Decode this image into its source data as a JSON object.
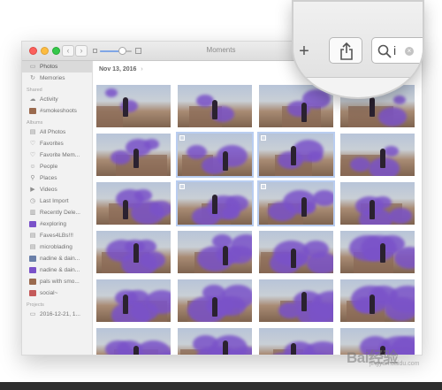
{
  "window": {
    "title": "Moments"
  },
  "toolbar": {
    "back_glyph": "‹",
    "forward_glyph": "›",
    "zoom_level": 0.7,
    "add_glyph": "+",
    "search_placeholder": ""
  },
  "sidebar": {
    "items_top": [
      {
        "label": "Photos",
        "icon": "photos-icon",
        "selected": true
      },
      {
        "label": "Memories",
        "icon": "memories-icon",
        "selected": false
      }
    ],
    "shared_heading": "Shared",
    "shared_items": [
      {
        "label": "Activity",
        "icon": "cloud-icon"
      },
      {
        "label": "#smokeshoots",
        "icon": "album-thumb-icon"
      }
    ],
    "albums_heading": "Albums",
    "album_items": [
      {
        "label": "All Photos",
        "icon": "album-stack-icon"
      },
      {
        "label": "Favorites",
        "icon": "heart-icon"
      },
      {
        "label": "Favorite Mem...",
        "icon": "heart-icon"
      },
      {
        "label": "People",
        "icon": "person-icon"
      },
      {
        "label": "Places",
        "icon": "pin-icon"
      },
      {
        "label": "Videos",
        "icon": "video-icon"
      },
      {
        "label": "Last Import",
        "icon": "clock-icon"
      },
      {
        "label": "Recently Dele...",
        "icon": "trash-icon"
      },
      {
        "label": "#exploring",
        "icon": "album-thumb-icon"
      },
      {
        "label": "Faves4LBs!!!",
        "icon": "album-stack-icon"
      },
      {
        "label": "microblading",
        "icon": "album-stack-icon"
      },
      {
        "label": "nadine & dain...",
        "icon": "album-thumb-icon"
      },
      {
        "label": "nadine & dain...",
        "icon": "album-thumb-icon"
      },
      {
        "label": "pals with smo...",
        "icon": "album-thumb-icon"
      },
      {
        "label": "social~",
        "icon": "album-thumb-icon"
      }
    ],
    "projects_heading": "Projects",
    "project_items": [
      {
        "label": "2016-12-21, 1...",
        "icon": "project-icon"
      }
    ]
  },
  "main": {
    "date_label": "Nov 13, 2016",
    "date_chevron": "›",
    "selected_photos": [
      5,
      6,
      9,
      10
    ],
    "photo_count": 24
  },
  "magnifier": {
    "search_text": "i",
    "clear_glyph": "×"
  },
  "watermark": {
    "text": "Bai经验",
    "sub": "jingyan.baidu.com"
  },
  "colors": {
    "accent": "#7fa6e6",
    "selection_outline": "#b9cdf0",
    "smoke": "#7a52c9"
  }
}
